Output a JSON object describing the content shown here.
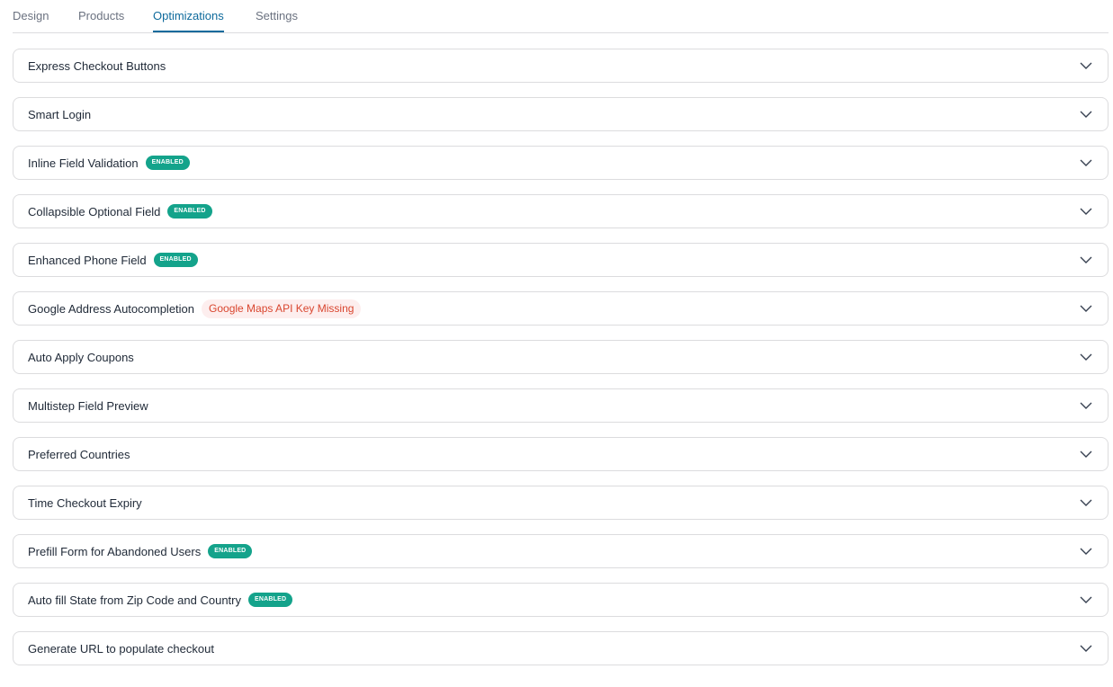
{
  "tabs": [
    {
      "label": "Design",
      "active": false
    },
    {
      "label": "Products",
      "active": false
    },
    {
      "label": "Optimizations",
      "active": true
    },
    {
      "label": "Settings",
      "active": false
    }
  ],
  "panels": [
    {
      "title": "Express Checkout Buttons"
    },
    {
      "title": "Smart Login"
    },
    {
      "title": "Inline Field Validation",
      "badge": "ENABLED"
    },
    {
      "title": "Collapsible Optional Field",
      "badge": "ENABLED"
    },
    {
      "title": "Enhanced Phone Field",
      "badge": "ENABLED"
    },
    {
      "title": "Google Address Autocompletion",
      "warning": "Google Maps API Key Missing"
    },
    {
      "title": "Auto Apply Coupons"
    },
    {
      "title": "Multistep Field Preview"
    },
    {
      "title": "Preferred Countries"
    },
    {
      "title": "Time Checkout Expiry"
    },
    {
      "title": "Prefill Form for Abandoned Users",
      "badge": "ENABLED"
    },
    {
      "title": "Auto fill State from Zip Code and Country",
      "badge": "ENABLED"
    },
    {
      "title": "Generate URL to populate checkout"
    }
  ],
  "colors": {
    "accent": "#0e6a9c",
    "badge_bg": "#14a38b",
    "warning_bg": "#fdeeee",
    "warning_text": "#d9462f",
    "border": "#dcdcde"
  },
  "icons": {
    "panel_toggle": "chevron-down-icon"
  }
}
